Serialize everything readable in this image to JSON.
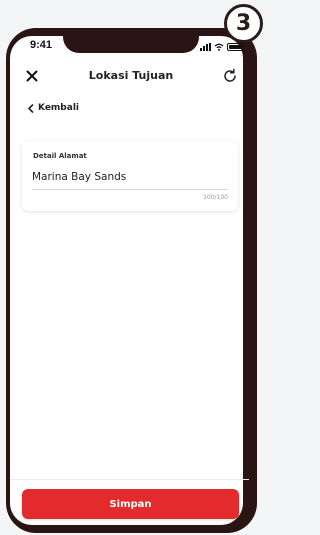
{
  "status_bar": {
    "time": "9:41"
  },
  "step_badge": "3",
  "header": {
    "title": "Lokasi Tujuan",
    "close_icon": "close-icon",
    "refresh_icon": "refresh-icon"
  },
  "back_link": {
    "label": "Kembali",
    "icon": "chevron-left-icon"
  },
  "address_card": {
    "label": "Detail Alamat",
    "value": "Marina Bay Sands",
    "counter": "100/100"
  },
  "footer": {
    "save_label": "Simpan"
  },
  "colors": {
    "accent": "#e32b2e",
    "frame": "#2a1414"
  }
}
